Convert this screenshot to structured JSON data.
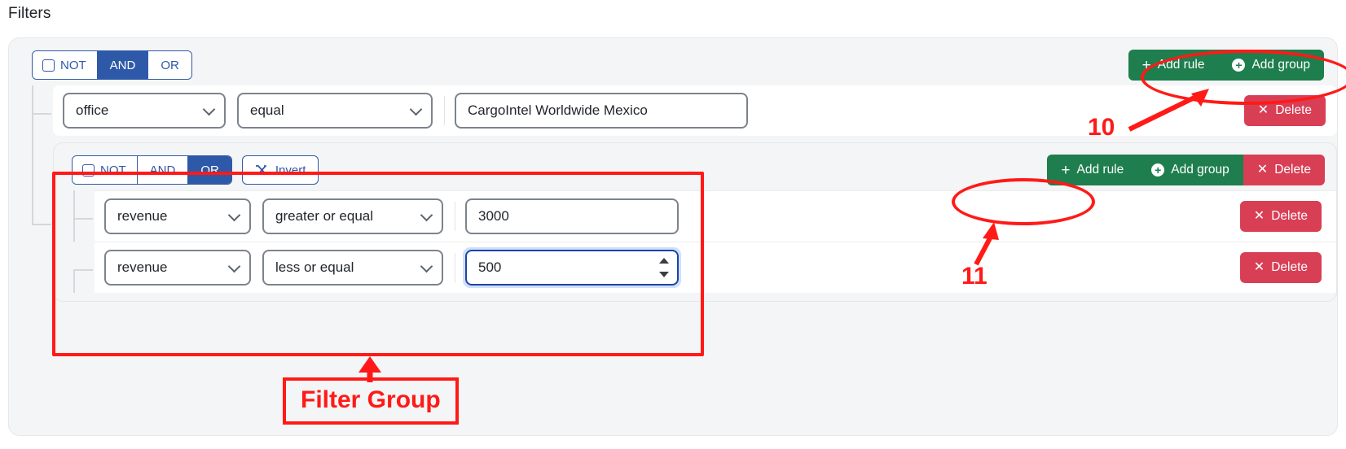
{
  "page": {
    "title": "Filters"
  },
  "root_group": {
    "combinator": {
      "not_label": "NOT",
      "and_label": "AND",
      "or_label": "OR",
      "selected": "AND"
    },
    "actions": {
      "add_rule": "Add rule",
      "add_group": "Add group"
    },
    "rule": {
      "field": "office",
      "operator": "equal",
      "value": "CargoIntel Worldwide Mexico",
      "delete_label": "Delete"
    }
  },
  "sub_group": {
    "combinator": {
      "not_label": "NOT",
      "and_label": "AND",
      "or_label": "OR",
      "selected": "OR"
    },
    "invert_label": "Invert",
    "actions": {
      "add_rule": "Add rule",
      "add_group": "Add group",
      "delete": "Delete"
    },
    "rules": [
      {
        "field": "revenue",
        "operator": "greater or equal",
        "value": "3000",
        "delete_label": "Delete",
        "focused": false
      },
      {
        "field": "revenue",
        "operator": "less or equal",
        "value": "500",
        "delete_label": "Delete",
        "focused": true
      }
    ]
  },
  "annotations": {
    "add_group_marker": "10",
    "add_rule_marker": "11",
    "filter_group_label": "Filter Group"
  },
  "colors": {
    "accent_blue": "#2e59a8",
    "green": "#1e7e4d",
    "red": "#d83f55",
    "annotation_red": "#ff1a17",
    "panel_bg": "#f4f5f6",
    "focus_blue": "#1c44a8"
  }
}
